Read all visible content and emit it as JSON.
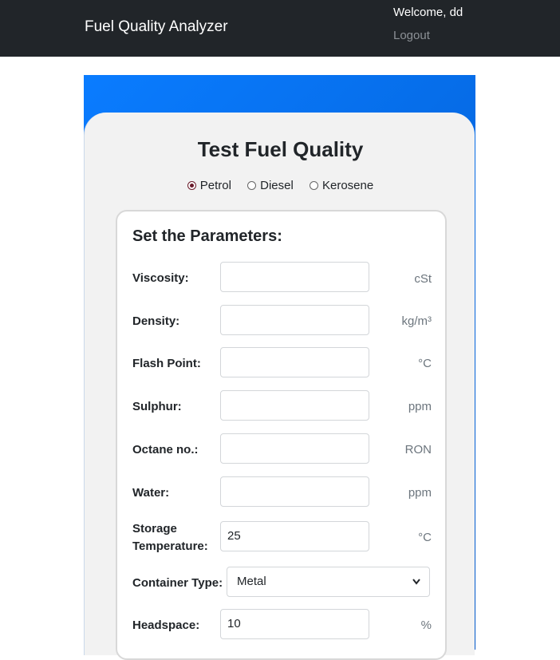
{
  "navbar": {
    "brand": "Fuel Quality Analyzer",
    "welcome": "Welcome, dd",
    "logout": "Logout"
  },
  "form": {
    "title": "Test Fuel Quality",
    "fuel_types": [
      {
        "label": "Petrol",
        "selected": true
      },
      {
        "label": "Diesel",
        "selected": false
      },
      {
        "label": "Kerosene",
        "selected": false
      }
    ],
    "panel_title": "Set the Parameters:",
    "fields": {
      "viscosity": {
        "label": "Viscosity:",
        "value": "",
        "unit": "cSt"
      },
      "density": {
        "label": "Density:",
        "value": "",
        "unit": "kg/m³"
      },
      "flash_point": {
        "label": "Flash Point:",
        "value": "",
        "unit": "°C"
      },
      "sulphur": {
        "label": "Sulphur:",
        "value": "",
        "unit": "ppm"
      },
      "octane": {
        "label": "Octane no.:",
        "value": "",
        "unit": "RON"
      },
      "water": {
        "label": "Water:",
        "value": "",
        "unit": "ppm"
      },
      "storage_temp": {
        "label_line1": "Storage",
        "label_line2": "Temperature:",
        "value": "25",
        "unit": "°C"
      },
      "container_type": {
        "label": "Container Type:",
        "value": "Metal"
      },
      "headspace": {
        "label": "Headspace:",
        "value": "10",
        "unit": "%"
      }
    }
  }
}
